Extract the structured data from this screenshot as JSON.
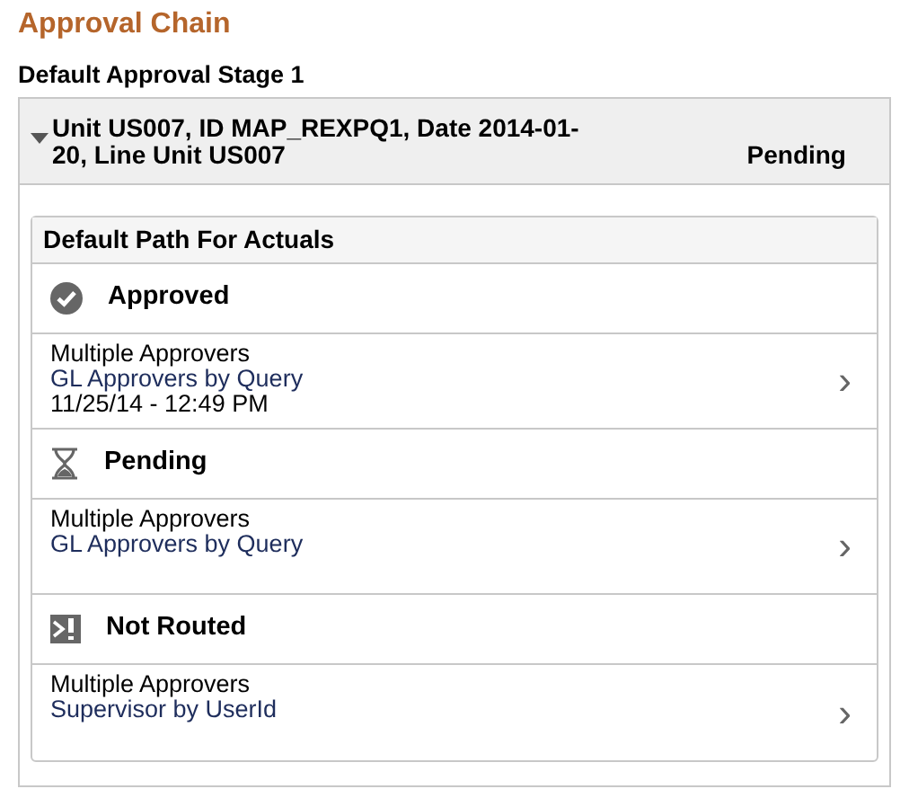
{
  "title": "Approval Chain",
  "stage": {
    "label": "Default Approval Stage 1",
    "header": {
      "expanded": true,
      "text": "Unit US007, ID MAP_REXPQ1, Date 2014-01-20, Line Unit US007",
      "status": "Pending"
    },
    "path": {
      "title": "Default Path For Actuals",
      "steps": [
        {
          "kind": "approved",
          "status": "Approved",
          "approver": "Multiple Approvers",
          "rule": "GL Approvers by Query",
          "date": "11/25/14 - 12:49 PM",
          "chevron": "›"
        },
        {
          "kind": "pending",
          "status": "Pending",
          "approver": "Multiple Approvers",
          "rule": "GL Approvers by Query",
          "chevron": "›"
        },
        {
          "kind": "not_routed",
          "status": "Not Routed",
          "approver": "Multiple Approvers",
          "rule": "Supervisor by UserId",
          "chevron": "›"
        }
      ]
    }
  }
}
